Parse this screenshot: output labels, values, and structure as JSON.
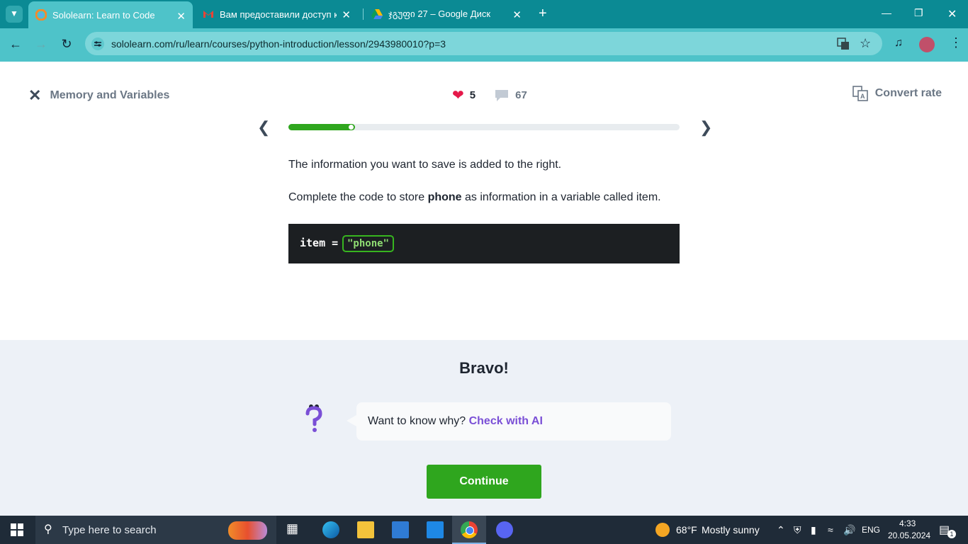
{
  "browser": {
    "tabs": [
      {
        "title": "Sololearn: Learn to Code",
        "active": true
      },
      {
        "title": "Вам предоставили доступ к па",
        "active": false
      },
      {
        "title": "ჯგუფი 27 – Google Диск",
        "active": false
      }
    ],
    "address": "sololearn.com/ru/learn/courses/python-introduction/lesson/2943980010?p=3"
  },
  "lesson": {
    "title": "Memory and Variables",
    "hearts": "5",
    "comments": "67",
    "convert_label": "Convert rate",
    "progress": 0.17,
    "para1": "The information you want to save is added to the right.",
    "para2_prefix": "Complete the code to store ",
    "para2_bold": "phone",
    "para2_suffix": " as information in a variable called item.",
    "code_var": "item =",
    "code_answer": "\"phone\""
  },
  "feedback": {
    "heading": "Bravo!",
    "prompt": "Want to know why?",
    "ai_link": "Check with AI",
    "continue_label": "Continue"
  },
  "taskbar": {
    "search_placeholder": "Type here to search",
    "weather_temp": "68°F",
    "weather_desc": "Mostly sunny",
    "lang": "ENG",
    "time": "4:33",
    "date": "20.05.2024",
    "notification_count": "1"
  },
  "colors": {
    "chrome_teal": "#0b8a94",
    "accent_green": "#2fa61e",
    "ai_purple": "#7a4fd6",
    "heart_red": "#e5194a"
  }
}
